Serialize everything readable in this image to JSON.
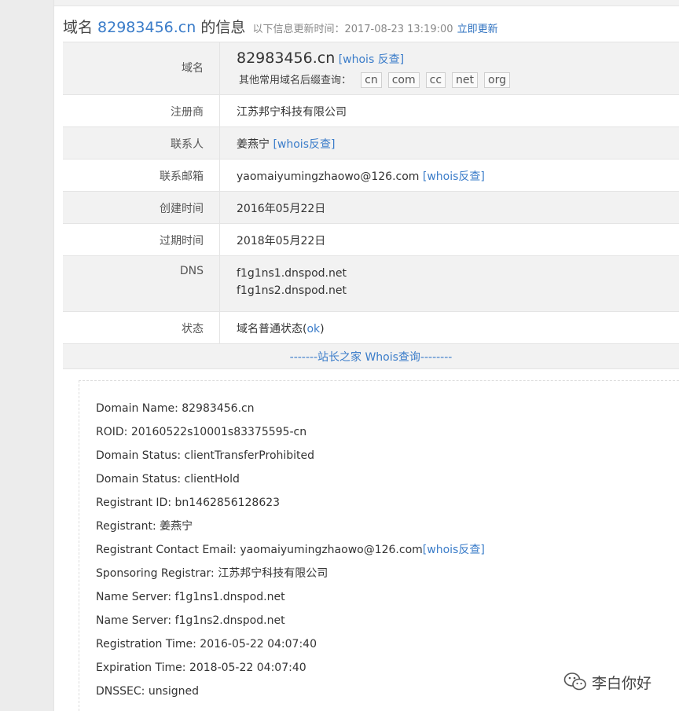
{
  "title": {
    "prefix": "域名 ",
    "domain": "82983456.cn",
    "suffix": " 的信息",
    "update_text": "以下信息更新时间：2017-08-23 13:19:00",
    "update_link": "立即更新"
  },
  "table": {
    "domain_label": "域名",
    "domain_value": "82983456.cn",
    "whois_reverse": "[whois 反查]",
    "suffix_prompt": "其他常用域名后缀查询：",
    "suffixes": [
      "cn",
      "com",
      "cc",
      "net",
      "org"
    ],
    "registrar_label": "注册商",
    "registrar_value": "江苏邦宁科技有限公司",
    "contact_label": "联系人",
    "contact_value": "姜燕宁",
    "contact_link": "[whois反查]",
    "email_label": "联系邮箱",
    "email_value": "yaomaiyumingzhaowo@126.com",
    "email_link": "[whois反查]",
    "created_label": "创建时间",
    "created_value": "2016年05月22日",
    "expire_label": "过期时间",
    "expire_value": "2018年05月22日",
    "dns_label": "DNS",
    "dns_values": [
      "f1g1ns1.dnspod.net",
      "f1g1ns2.dnspod.net"
    ],
    "status_label": "状态",
    "status_prefix": "域名普通状态(",
    "status_link": "ok",
    "status_suffix": ")",
    "banner": "-------站长之家 Whois查询--------"
  },
  "whois": {
    "lines": [
      "Domain Name: 82983456.cn",
      "ROID: 20160522s10001s83375595-cn",
      "Domain Status: clientTransferProhibited",
      "Domain Status: clientHold",
      "Registrant ID: bn1462856128623",
      "Registrant: 姜燕宁",
      "Registrant Contact Email: yaomaiyumingzhaowo@126.com",
      "Sponsoring Registrar: 江苏邦宁科技有限公司",
      "Name Server: f1g1ns1.dnspod.net",
      "Name Server: f1g1ns2.dnspod.net",
      "Registration Time: 2016-05-22 04:07:40",
      "Expiration Time: 2018-05-22 04:07:40",
      "DNSSEC: unsigned"
    ],
    "email_link": "[whois反查]"
  },
  "watermark": {
    "text": "李白你好",
    "icon": "wechat-icon"
  },
  "colors": {
    "link": "#3a7cc9",
    "shaded_row": "#f2f2f2"
  }
}
